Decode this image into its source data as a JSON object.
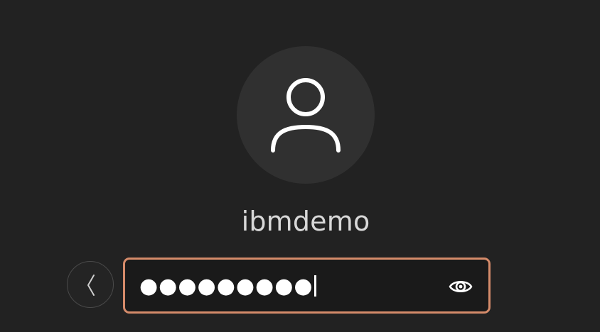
{
  "login": {
    "avatar_icon": "user-icon",
    "username": "ibmdemo",
    "password_value": "●●●●●●●●●",
    "back_icon": "chevron-left-icon",
    "reveal_icon": "eye-icon"
  },
  "colors": {
    "background": "#222222",
    "avatar_bg": "#303030",
    "field_bg": "#1a1a1a",
    "focus_border": "#d58b6a",
    "text": "#d8d8d8"
  }
}
